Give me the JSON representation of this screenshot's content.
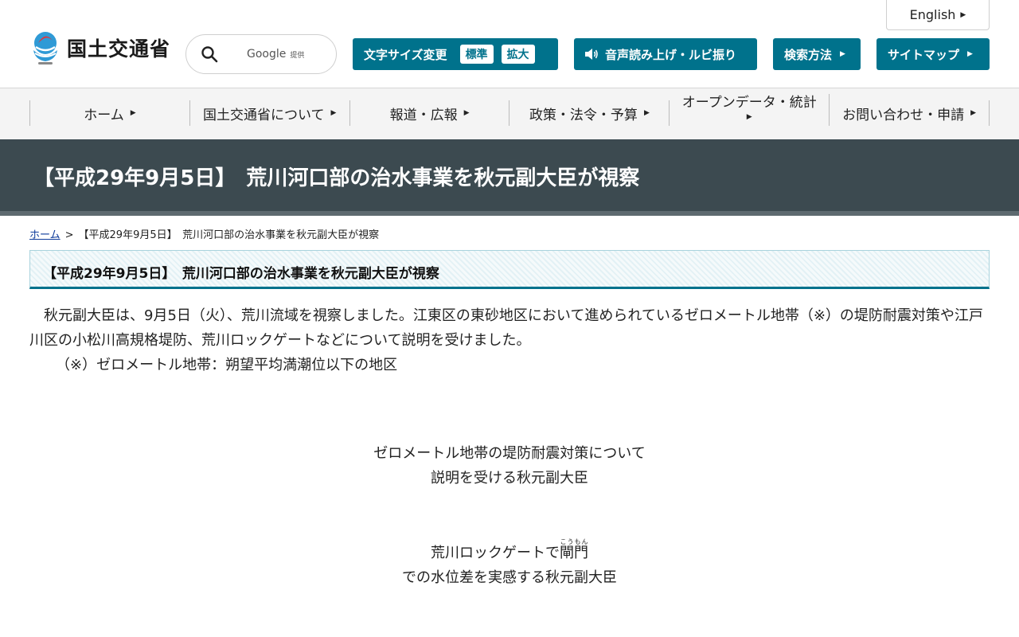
{
  "header": {
    "english_label": "English",
    "logo_text": "国土交通省",
    "search": {
      "google_label": "Google",
      "provided_label": "提供"
    },
    "font_size": {
      "label": "文字サイズ変更",
      "standard": "標準",
      "large": "拡大"
    },
    "voice_label": "音声読み上げ・ルビ振り",
    "search_method_label": "検索方法",
    "sitemap_label": "サイトマップ",
    "accent_color": "#00728c"
  },
  "gnav": {
    "items": [
      "ホーム",
      "国土交通省について",
      "報道・広報",
      "政策・法令・予算",
      "オープンデータ・統計",
      "お問い合わせ・申請"
    ]
  },
  "page": {
    "title": "【平成29年9月5日】　荒川河口部の治水事業を秋元副大臣が視察",
    "breadcrumb": {
      "home": "ホーム",
      "separator": ">",
      "current": "【平成29年9月5日】　荒川河口部の治水事業を秋元副大臣が視察"
    },
    "heading": "【平成29年9月5日】　荒川河口部の治水事業を秋元副大臣が視察",
    "body_line1": "　秋元副大臣は、9月5日（火）、荒川流域を視察しました。江東区の東砂地区において進められているゼロメートル地帯（※）の堤防耐震対策や江戸川区の小松川高規格堤防、荒川ロックゲートなどについて説明を受けました。",
    "note": "（※）ゼロメートル地帯：朔望平均満潮位以下の地区",
    "caption1_line1": "ゼロメートル地帯の堤防耐震対策について",
    "caption1_line2": "説明を受ける秋元副大臣",
    "caption2_line1_pre": "荒川ロックゲートで",
    "caption2_ruby_base": "閘門",
    "caption2_ruby_text": "こうもん",
    "caption2_line2": "での水位差を実感する秋元副大臣"
  }
}
